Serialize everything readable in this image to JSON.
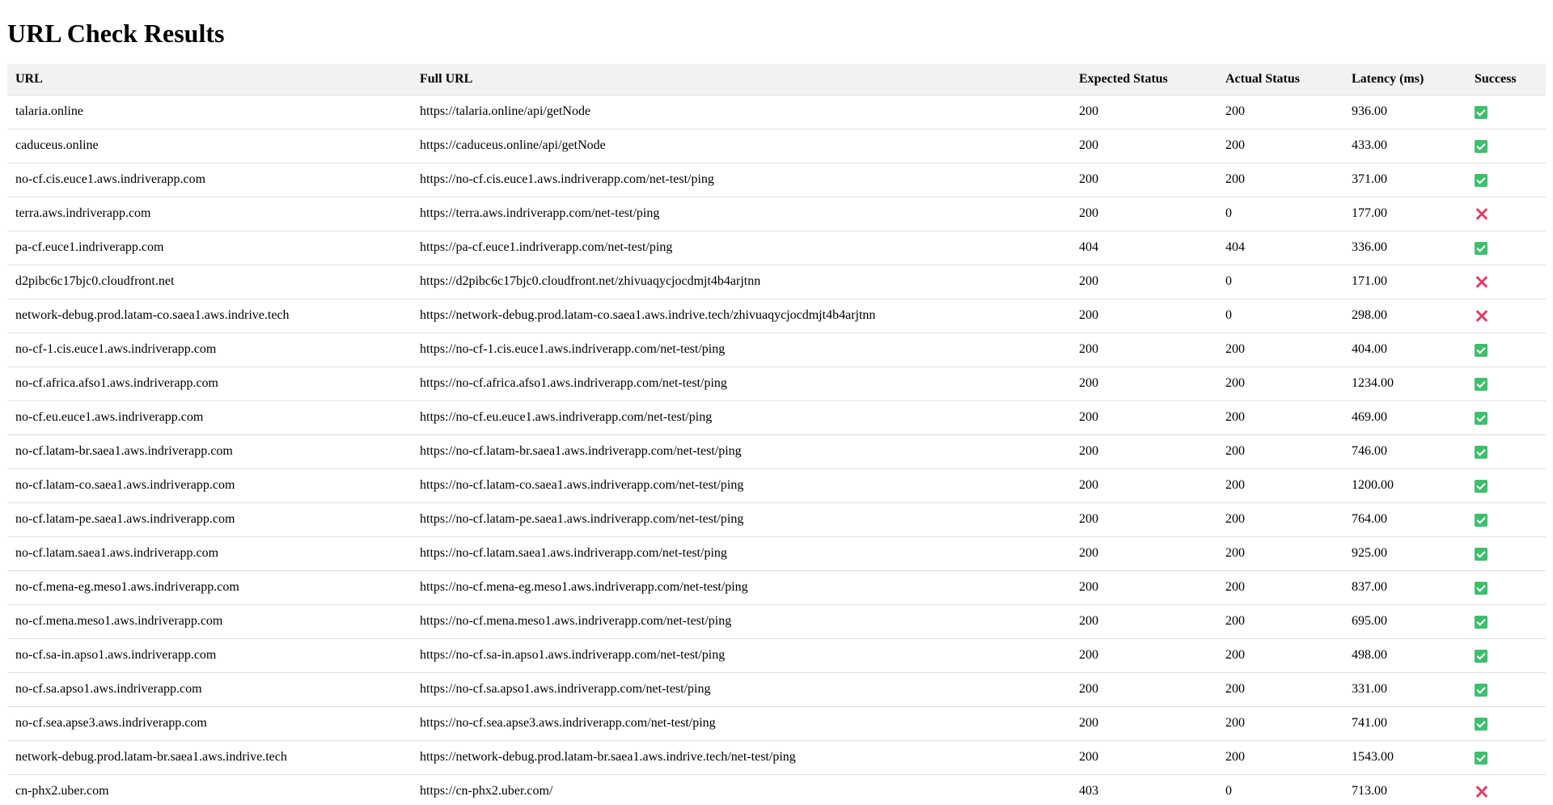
{
  "page": {
    "title": "URL Check Results"
  },
  "table": {
    "headers": {
      "url": "URL",
      "full_url": "Full URL",
      "expected": "Expected Status",
      "actual": "Actual Status",
      "latency": "Latency (ms)",
      "success": "Success"
    },
    "rows": [
      {
        "url": "talaria.online",
        "full_url": "https://talaria.online/api/getNode",
        "expected": "200",
        "actual": "200",
        "latency": "936.00",
        "success": "success-check-icon"
      },
      {
        "url": "caduceus.online",
        "full_url": "https://caduceus.online/api/getNode",
        "expected": "200",
        "actual": "200",
        "latency": "433.00",
        "success": "success-check-icon"
      },
      {
        "url": "no-cf.cis.euce1.aws.indriverapp.com",
        "full_url": "https://no-cf.cis.euce1.aws.indriverapp.com/net-test/ping",
        "expected": "200",
        "actual": "200",
        "latency": "371.00",
        "success": "success-check-icon"
      },
      {
        "url": "terra.aws.indriverapp.com",
        "full_url": "https://terra.aws.indriverapp.com/net-test/ping",
        "expected": "200",
        "actual": "0",
        "latency": "177.00",
        "success": "failure-cross-icon"
      },
      {
        "url": "pa-cf.euce1.indriverapp.com",
        "full_url": "https://pa-cf.euce1.indriverapp.com/net-test/ping",
        "expected": "404",
        "actual": "404",
        "latency": "336.00",
        "success": "success-check-icon"
      },
      {
        "url": "d2pibc6c17bjc0.cloudfront.net",
        "full_url": "https://d2pibc6c17bjc0.cloudfront.net/zhivuaqycjocdmjt4b4arjtnn",
        "expected": "200",
        "actual": "0",
        "latency": "171.00",
        "success": "failure-cross-icon"
      },
      {
        "url": "network-debug.prod.latam-co.saea1.aws.indrive.tech",
        "full_url": "https://network-debug.prod.latam-co.saea1.aws.indrive.tech/zhivuaqycjocdmjt4b4arjtnn",
        "expected": "200",
        "actual": "0",
        "latency": "298.00",
        "success": "failure-cross-icon"
      },
      {
        "url": "no-cf-1.cis.euce1.aws.indriverapp.com",
        "full_url": "https://no-cf-1.cis.euce1.aws.indriverapp.com/net-test/ping",
        "expected": "200",
        "actual": "200",
        "latency": "404.00",
        "success": "success-check-icon"
      },
      {
        "url": "no-cf.africa.afso1.aws.indriverapp.com",
        "full_url": "https://no-cf.africa.afso1.aws.indriverapp.com/net-test/ping",
        "expected": "200",
        "actual": "200",
        "latency": "1234.00",
        "success": "success-check-icon"
      },
      {
        "url": "no-cf.eu.euce1.aws.indriverapp.com",
        "full_url": "https://no-cf.eu.euce1.aws.indriverapp.com/net-test/ping",
        "expected": "200",
        "actual": "200",
        "latency": "469.00",
        "success": "success-check-icon"
      },
      {
        "url": "no-cf.latam-br.saea1.aws.indriverapp.com",
        "full_url": "https://no-cf.latam-br.saea1.aws.indriverapp.com/net-test/ping",
        "expected": "200",
        "actual": "200",
        "latency": "746.00",
        "success": "success-check-icon"
      },
      {
        "url": "no-cf.latam-co.saea1.aws.indriverapp.com",
        "full_url": "https://no-cf.latam-co.saea1.aws.indriverapp.com/net-test/ping",
        "expected": "200",
        "actual": "200",
        "latency": "1200.00",
        "success": "success-check-icon"
      },
      {
        "url": "no-cf.latam-pe.saea1.aws.indriverapp.com",
        "full_url": "https://no-cf.latam-pe.saea1.aws.indriverapp.com/net-test/ping",
        "expected": "200",
        "actual": "200",
        "latency": "764.00",
        "success": "success-check-icon"
      },
      {
        "url": "no-cf.latam.saea1.aws.indriverapp.com",
        "full_url": "https://no-cf.latam.saea1.aws.indriverapp.com/net-test/ping",
        "expected": "200",
        "actual": "200",
        "latency": "925.00",
        "success": "success-check-icon"
      },
      {
        "url": "no-cf.mena-eg.meso1.aws.indriverapp.com",
        "full_url": "https://no-cf.mena-eg.meso1.aws.indriverapp.com/net-test/ping",
        "expected": "200",
        "actual": "200",
        "latency": "837.00",
        "success": "success-check-icon"
      },
      {
        "url": "no-cf.mena.meso1.aws.indriverapp.com",
        "full_url": "https://no-cf.mena.meso1.aws.indriverapp.com/net-test/ping",
        "expected": "200",
        "actual": "200",
        "latency": "695.00",
        "success": "success-check-icon"
      },
      {
        "url": "no-cf.sa-in.apso1.aws.indriverapp.com",
        "full_url": "https://no-cf.sa-in.apso1.aws.indriverapp.com/net-test/ping",
        "expected": "200",
        "actual": "200",
        "latency": "498.00",
        "success": "success-check-icon"
      },
      {
        "url": "no-cf.sa.apso1.aws.indriverapp.com",
        "full_url": "https://no-cf.sa.apso1.aws.indriverapp.com/net-test/ping",
        "expected": "200",
        "actual": "200",
        "latency": "331.00",
        "success": "success-check-icon"
      },
      {
        "url": "no-cf.sea.apse3.aws.indriverapp.com",
        "full_url": "https://no-cf.sea.apse3.aws.indriverapp.com/net-test/ping",
        "expected": "200",
        "actual": "200",
        "latency": "741.00",
        "success": "success-check-icon"
      },
      {
        "url": "network-debug.prod.latam-br.saea1.aws.indrive.tech",
        "full_url": "https://network-debug.prod.latam-br.saea1.aws.indrive.tech/net-test/ping",
        "expected": "200",
        "actual": "200",
        "latency": "1543.00",
        "success": "success-check-icon"
      },
      {
        "url": "cn-phx2.uber.com",
        "full_url": "https://cn-phx2.uber.com/",
        "expected": "403",
        "actual": "0",
        "latency": "713.00",
        "success": "failure-cross-icon"
      }
    ]
  },
  "colors": {
    "success": "#3fbf6e",
    "failure": "#e0406a",
    "header_bg": "#f2f2f2",
    "row_border": "#dddddd"
  }
}
